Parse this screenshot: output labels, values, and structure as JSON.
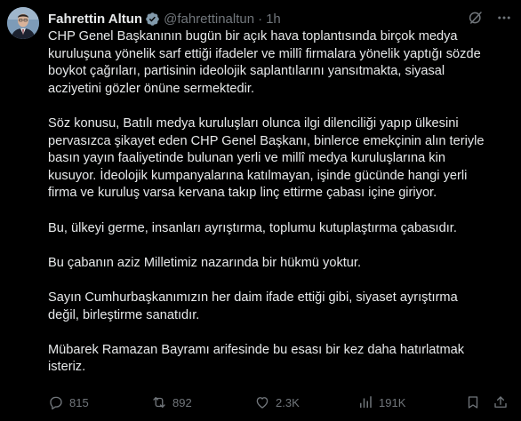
{
  "tweet": {
    "author_name": "Fahrettin Altun",
    "handle": "@fahrettinaltun",
    "separator": "·",
    "time": "1h",
    "paragraphs": [
      "CHP Genel Başkanının bugün bir açık hava toplantısında birçok medya\nkuruluşuna yönelik sarf ettiği ifadeler ve millî firmalara yönelik yaptığı sözde\nboykot çağrıları, partisinin ideolojik saplantılarını yansıtmakta, siyasal\nacziyetini gözler önüne sermektedir.",
      "Söz konusu, Batılı medya kuruluşları olunca ilgi dilenciliği yapıp ülkesini\npervasızca şikayet eden CHP Genel Başkanı, binlerce emekçinin alın teriyle\nbasın yayın faaliyetinde bulunan yerli ve millî medya kuruluşlarına kin\nkusuyor. İdeolojik kumpanyalarına katılmayan, işinde gücünde hangi yerli\nfirma ve kuruluş varsa kervana takıp linç ettirme çabası içine giriyor.",
      "Bu, ülkeyi germe, insanları ayrıştırma, toplumu kutuplaştırma çabasıdır.",
      "Bu çabanın aziz Milletimiz nazarında bir hükmü yoktur.",
      "Sayın Cumhurbaşkanımızın her daim ifade ettiği gibi, siyaset ayrıştırma\ndeğil, birleştirme sanatıdır.",
      "Mübarek Ramazan Bayramı arifesinde bu esası bir kez daha hatırlatmak\nisteriz."
    ]
  },
  "actions": {
    "replies": "815",
    "reposts": "892",
    "likes": "2.3K",
    "views": "191K"
  },
  "icons": {
    "verified": "verified-badge-icon",
    "grok": "grok-icon",
    "more": "more-options-icon",
    "reply": "reply-icon",
    "repost": "repost-icon",
    "like": "heart-icon",
    "views": "views-chart-icon",
    "bookmark": "bookmark-icon",
    "share": "share-icon"
  },
  "colors": {
    "background": "#000000",
    "text": "#e7e9ea",
    "muted": "#71767b",
    "verified_badge": "#829aab"
  }
}
